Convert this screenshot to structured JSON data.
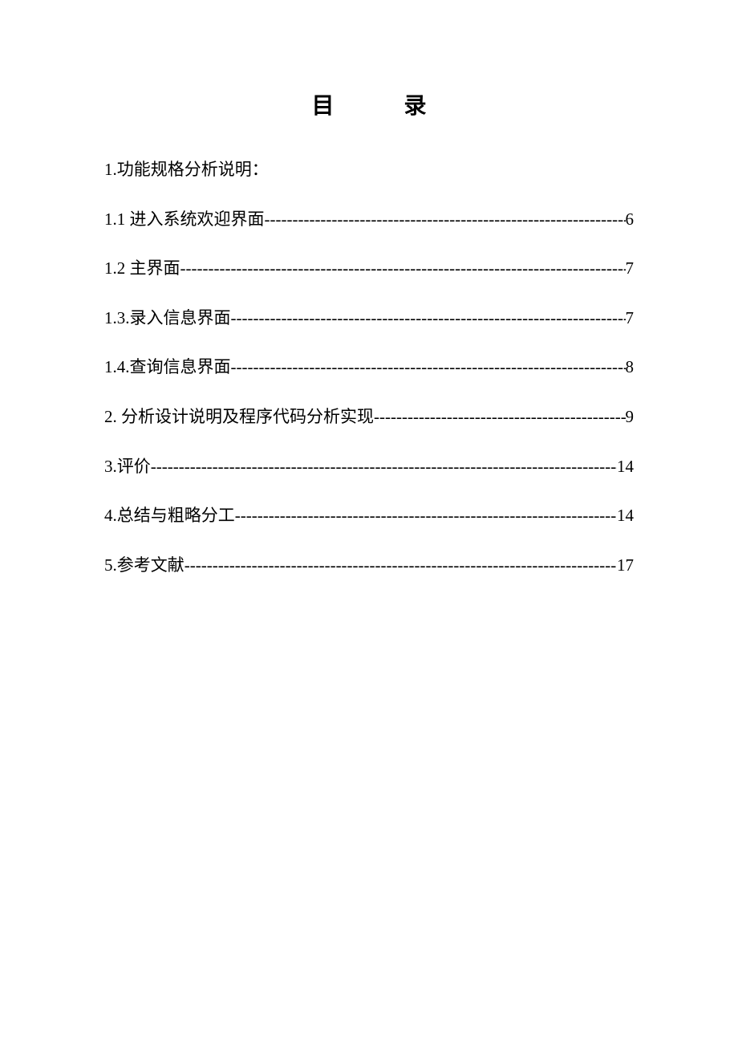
{
  "title": "目 录",
  "heading": "1.功能规格分析说明：",
  "entries": [
    {
      "label": "1.1  进入系统欢迎界面",
      "page": "6"
    },
    {
      "label": "1.2 主界面",
      "page": "7"
    },
    {
      "label": "1.3.录入信息界面",
      "page": "7"
    },
    {
      "label": "1.4.查询信息界面",
      "page": "8"
    },
    {
      "label": "2.  分析设计说明及程序代码分析实现",
      "page": "9"
    },
    {
      "label": "3.评价",
      "page": "14"
    },
    {
      "label": "4.总结与粗略分工",
      "page": "14"
    },
    {
      "label": "5.参考文献",
      "page": "17"
    }
  ]
}
